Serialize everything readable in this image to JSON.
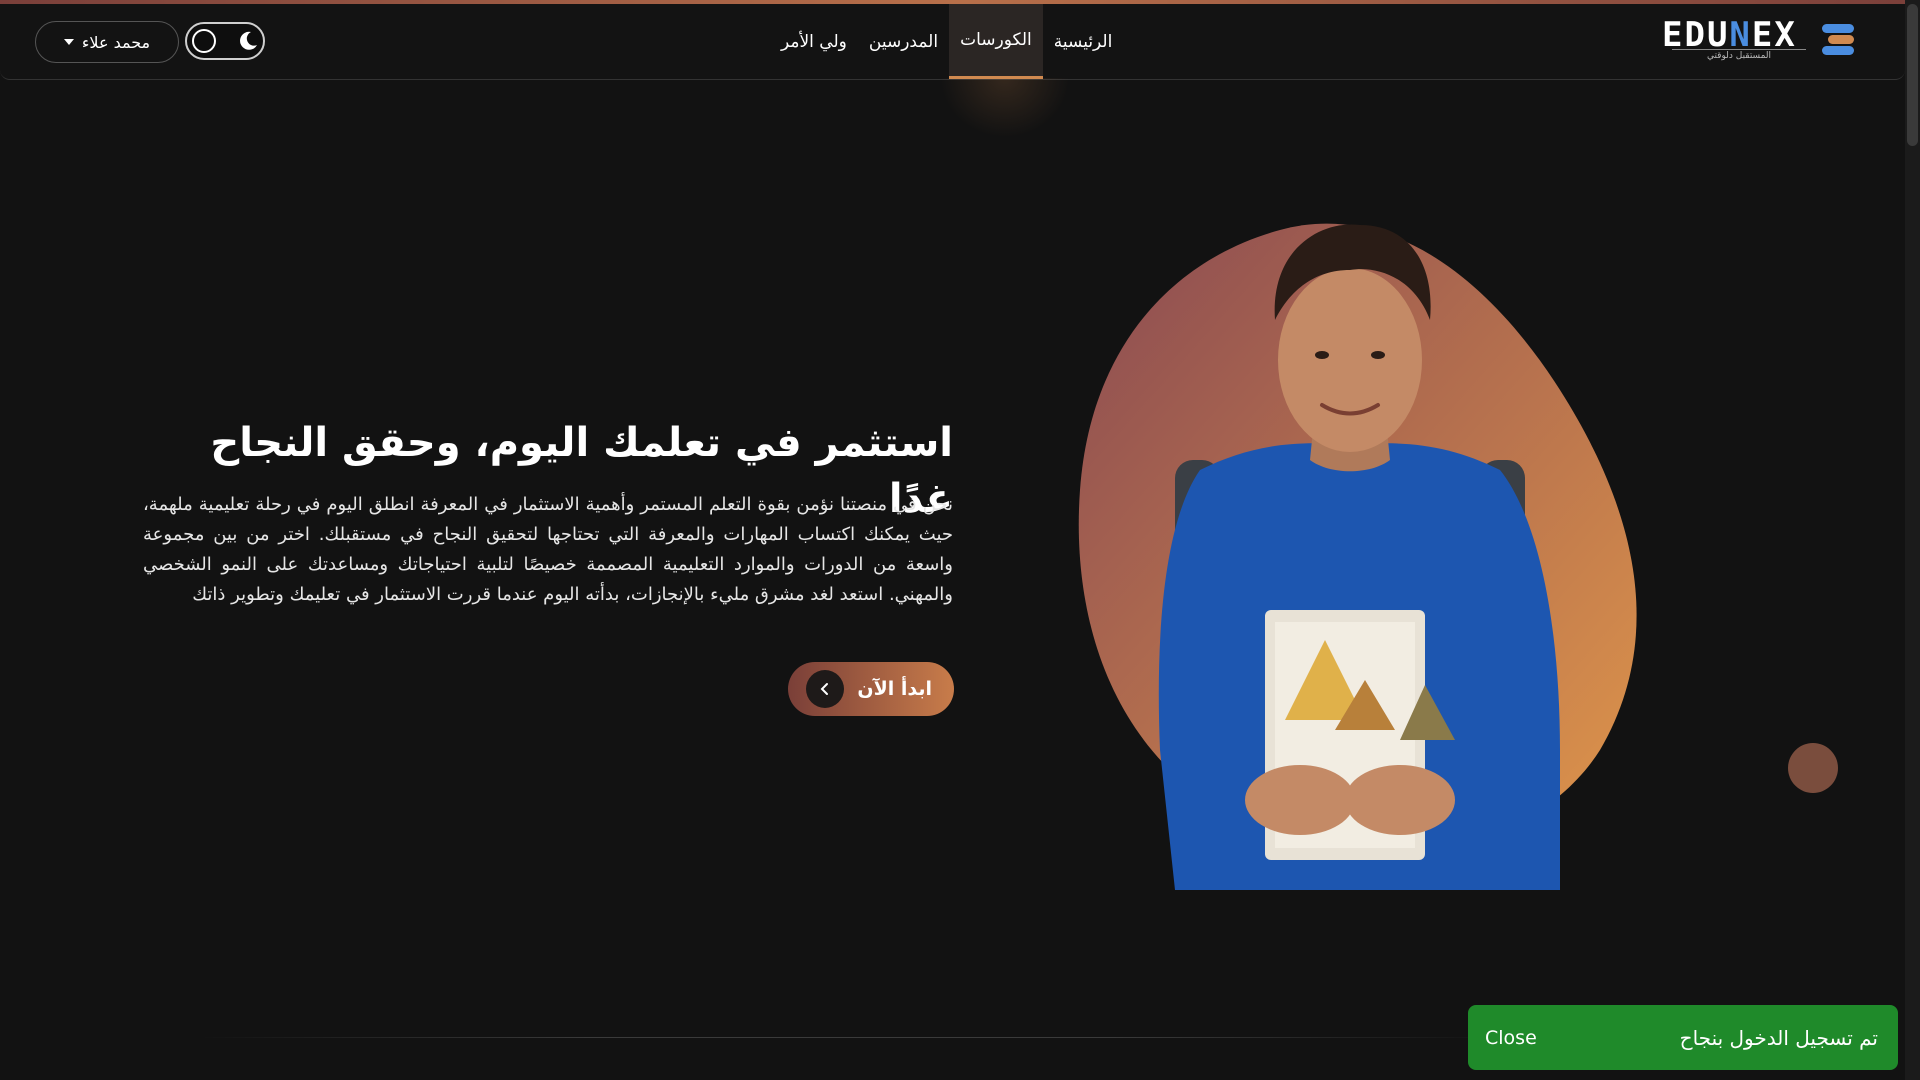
{
  "header": {
    "logo_text_a": "EDU",
    "logo_text_b": "N",
    "logo_text_c": "EX",
    "logo_tagline": "المستقبل دلوقتي",
    "nav": [
      {
        "label": "الرئيسية"
      },
      {
        "label": "الكورسات",
        "active": true
      },
      {
        "label": "المدرسين"
      },
      {
        "label": "ولي الأمر"
      }
    ],
    "user_name": "محمد علاء",
    "theme": "dark"
  },
  "hero": {
    "title": "استثمر في تعلمك اليوم، وحقق النجاح غدًا",
    "description": "نحن في منصتنا نؤمن بقوة التعلم المستمر وأهمية الاستثمار في المعرفة انطلق اليوم في رحلة تعليمية ملهمة، حيث يمكنك اكتساب المهارات والمعرفة التي تحتاجها لتحقيق النجاح في مستقبلك. اختر من بين مجموعة واسعة من الدورات والموارد التعليمية المصممة خصيصًا لتلبية احتياجاتك ومساعدتك على النمو الشخصي والمهني. استعد لغد مشرق مليء بالإنجازات، بدأته اليوم عندما قررت الاستثمار في تعليمك وتطوير ذاتك",
    "cta_label": "ابدأ الآن"
  },
  "toast": {
    "message": "تم تسجيل الدخول بنجاح",
    "close_label": "Close"
  },
  "colors": {
    "background": "#121212",
    "accent": "#d18a50",
    "toast": "#1f8a2a",
    "brand_blue": "#4a8de0"
  },
  "icons": {
    "moon": "moon-icon",
    "caret": "caret-down-icon",
    "cta_arrow": "chevron-left-icon"
  }
}
